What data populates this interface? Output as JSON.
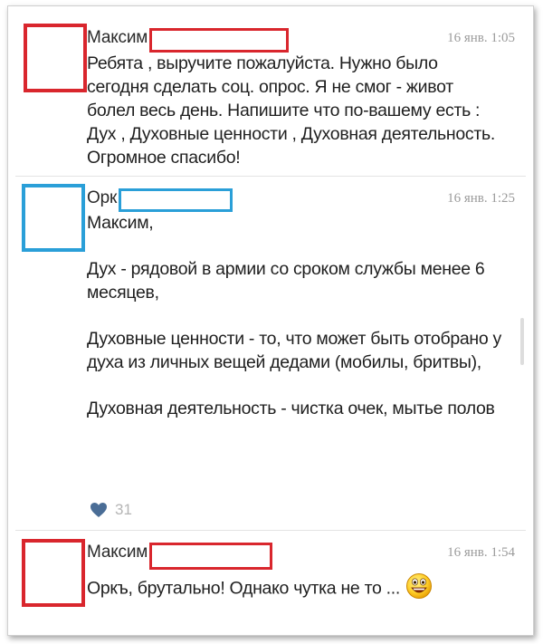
{
  "colors": {
    "red_frame": "#d9262d",
    "blue_frame": "#2a9fd8",
    "like_heart": "#4a6d96"
  },
  "comments": [
    {
      "author": "Максим",
      "time": "16 янв. 1:05",
      "text": "Ребята , выручите пожалуйста. Нужно было сегодня сделать соц. опрос. Я не смог - живот болел весь день. Напишите что по-вашему есть : Дух , Духовные ценности , Духовная деятельность. Огромное спасибо!"
    },
    {
      "author": "Орк",
      "time": "16 янв. 1:25",
      "paragraphs": [
        "Максим,",
        "Дух - рядовой в армии со сроком службы менее 6 месяцев,",
        "Духовные ценности - то, что может быть отобрано у духа из личных вещей дедами (мобилы, бритвы),",
        "Духовная деятельность - чистка очек, мытье полов"
      ],
      "likes": "31"
    },
    {
      "author": "Максим",
      "time": "16 янв. 1:54",
      "text": "Оркъ, брутально! Однако чутка не то ...",
      "emoji": "grinning-face-icon"
    }
  ]
}
